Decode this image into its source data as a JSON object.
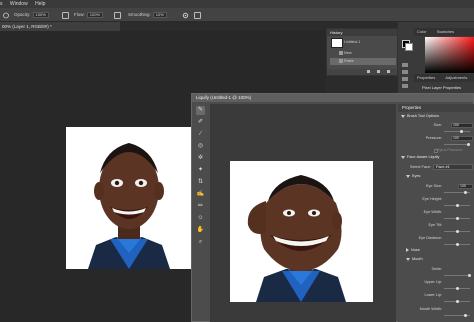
{
  "menubar": {
    "items": [
      "s",
      "Window",
      "Help"
    ]
  },
  "options": {
    "opacity_label": "Opacity:",
    "opacity_value": "100%",
    "flow_label": "Flow:",
    "flow_value": "100%",
    "smoothing_label": "Smoothing:",
    "smoothing_value": "10%"
  },
  "document": {
    "tab_title": "00% (Layer 1, RGB/8#) *"
  },
  "history": {
    "title": "History",
    "snapshot_label": "Untitled-1",
    "items": [
      "New",
      "Paste"
    ]
  },
  "color_panel": {
    "tabs": [
      "Color",
      "Swatches"
    ]
  },
  "props_panel": {
    "tabs": [
      "Properties",
      "Adjustments"
    ],
    "layer_label": "Pixel Layer Properties"
  },
  "liquify": {
    "title": "Liquify (Untitled-1 @ 100%)",
    "properties_title": "Properties",
    "brush_options_label": "Brush Tool Options",
    "size_label": "Size:",
    "size_value": "100",
    "pressure_label": "Pressure:",
    "pressure_value": "100",
    "stylus_label": "Stylus Pressure",
    "face_aware_label": "Face-Aware Liquify",
    "select_face_label": "Select Face:",
    "select_face_value": "Face #1",
    "eyes_label": "Eyes",
    "eye_size_label": "Eye Size:",
    "eye_size_value": "100",
    "eye_height_label": "Eye Height:",
    "eye_width_label": "Eye Width:",
    "eye_tilt_label": "Eye Tilt:",
    "eye_distance_label": "Eye Distance:",
    "nose_label": "Nose",
    "mouth_label": "Mouth",
    "smile_label": "Smile:",
    "upper_lip_label": "Upper Lip:",
    "lower_lip_label": "Lower Lip:",
    "mouth_width_label": "Mouth Width:"
  },
  "icons": [
    "brush-icon",
    "gear-icon",
    "airbrush-icon",
    "forward-warp-icon",
    "reconstruct-icon",
    "smooth-icon",
    "twirl-icon",
    "pucker-icon",
    "bloat-icon",
    "push-left-icon",
    "freeze-mask-icon",
    "thaw-mask-icon",
    "face-tool-icon",
    "hand-icon",
    "zoom-icon"
  ]
}
